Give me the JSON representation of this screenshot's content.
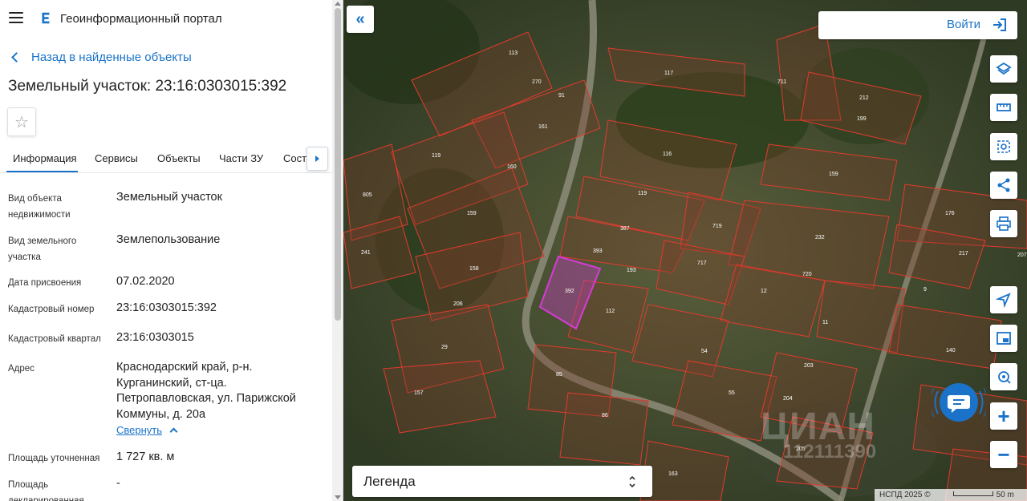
{
  "app": {
    "title": "Геоинформационный портал"
  },
  "nav": {
    "back_label": "Назад в найденные объекты"
  },
  "page": {
    "title": "Земельный участок: 23:16:0303015:392"
  },
  "tabs": [
    {
      "label": "Информация",
      "active": true
    },
    {
      "label": "Сервисы"
    },
    {
      "label": "Объекты"
    },
    {
      "label": "Части ЗУ"
    },
    {
      "label": "Соста"
    }
  ],
  "info": {
    "object_type": {
      "label": "Вид объекта недвижимости",
      "value": "Земельный участок"
    },
    "land_type": {
      "label": "Вид земельного участка",
      "value": "Землепользование"
    },
    "assigned_date": {
      "label": "Дата присвоения",
      "value": "07.02.2020"
    },
    "cadastral_number": {
      "label": "Кадастровый номер",
      "value": "23:16:0303015:392"
    },
    "cadastral_quarter": {
      "label": "Кадастровый квартал",
      "value": "23:16:0303015"
    },
    "address": {
      "label": "Адрес",
      "value": "Краснодарский край, р-н. Курганинский, ст-ца. Петропавловская, ул. Парижской Коммуны, д. 20а"
    },
    "collapse_label": "Свернуть",
    "area_precise": {
      "label": "Площадь уточненная",
      "value": "1 727 кв. м"
    },
    "area_declared": {
      "label": "Площадь декларированная",
      "value": "-"
    }
  },
  "map": {
    "login_label": "Войти",
    "legend_label": "Легенда",
    "zoom_in": "+",
    "zoom_out": "−",
    "attribution": "НСПД 2025 ©",
    "scale": "50 m",
    "watermark": "ЦИАН",
    "watermark_phone": "112111390",
    "selected_parcel": "392",
    "parcel_labels": [
      "113",
      "270",
      "91",
      "161",
      "117",
      "711",
      "212",
      "199",
      "119",
      "160",
      "159",
      "805",
      "241",
      "158",
      "206",
      "29",
      "157",
      "85",
      "86",
      "393",
      "392",
      "193",
      "112",
      "387",
      "119",
      "116",
      "719",
      "717",
      "12",
      "720",
      "232",
      "159",
      "176",
      "217",
      "207",
      "9",
      "11",
      "140",
      "54",
      "55",
      "203",
      "204",
      "205",
      "163"
    ],
    "accent_color": "#1a73c8",
    "selected_color": "#d63bd6",
    "boundary_color": "#e23b2e"
  }
}
